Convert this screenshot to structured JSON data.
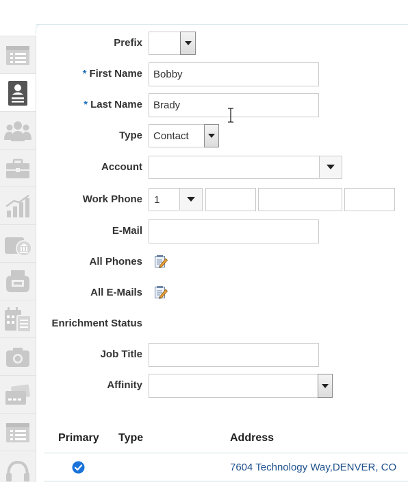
{
  "form": {
    "prefix_label": "Prefix",
    "prefix_value": "",
    "first_name_label": "First Name",
    "first_name_value": "Bobby",
    "last_name_label": "Last Name",
    "last_name_value": "Brady",
    "required_marker": "*",
    "type_label": "Type",
    "type_value": "Contact",
    "account_label": "Account",
    "account_value": "",
    "work_phone_label": "Work Phone",
    "work_phone_country": "1",
    "work_phone_area": "",
    "work_phone_number": "",
    "work_phone_ext": "",
    "email_label": "E-Mail",
    "email_value": "",
    "all_phones_label": "All Phones",
    "all_emails_label": "All E-Mails",
    "enrichment_label": "Enrichment Status",
    "job_title_label": "Job Title",
    "job_title_value": "",
    "affinity_label": "Affinity",
    "affinity_value": ""
  },
  "address_table": {
    "columns": [
      "Primary",
      "Type",
      "Address"
    ],
    "rows": [
      {
        "primary": true,
        "type": "",
        "address": "7604 Technology Way,DENVER, CO"
      }
    ]
  },
  "sidebar": {
    "items": [
      "list-icon",
      "contact-card-icon",
      "people-icon",
      "briefcase-icon",
      "chart-icon",
      "bank-icon",
      "printer-icon",
      "calendar-icon",
      "camera-icon",
      "cards-icon",
      "list-icon",
      "headset-icon"
    ],
    "active_index": 1
  },
  "colors": {
    "accent": "#1f6fb7",
    "link": "#1c4f8a",
    "check": "#1a73d9"
  }
}
